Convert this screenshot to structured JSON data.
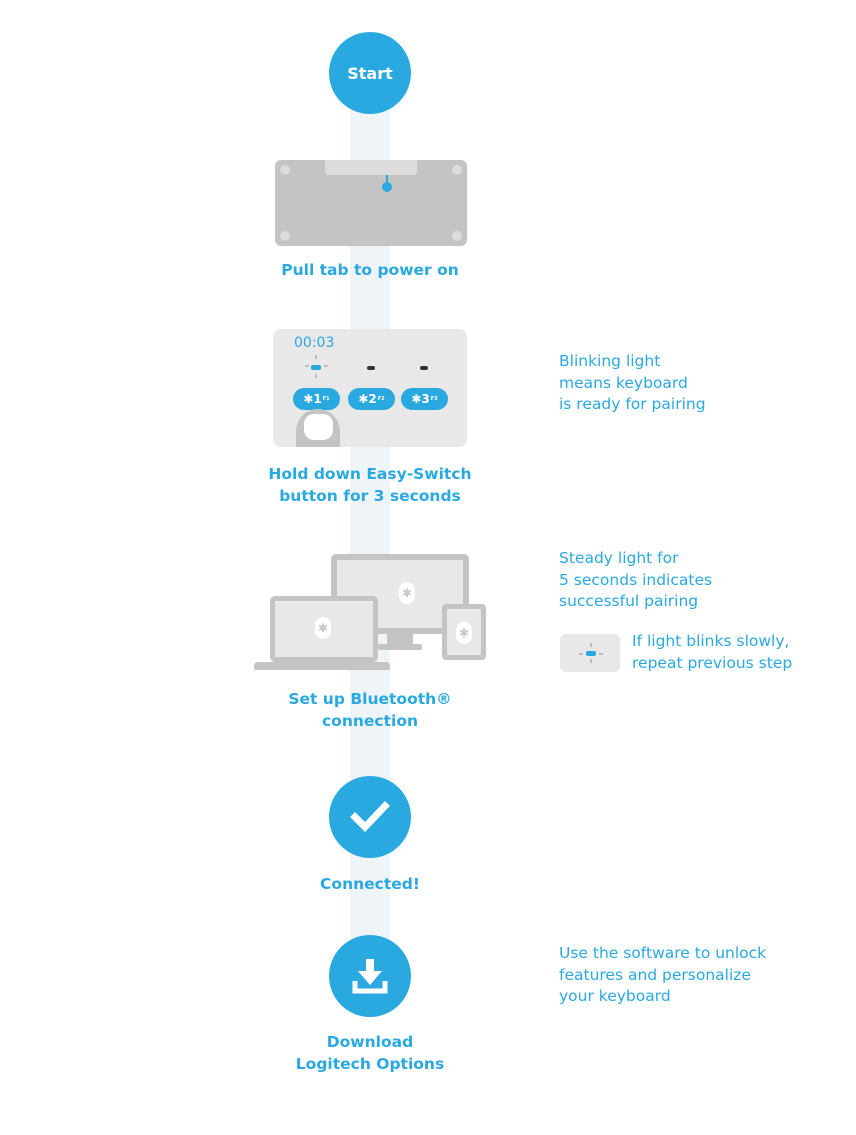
{
  "colors": {
    "accent": "#2aa8e0",
    "track": "#eef4f8",
    "device_gray": "#c4c4c4",
    "card_bg": "#e8e8e8"
  },
  "start": {
    "label": "Start"
  },
  "steps": [
    {
      "label": "Pull tab to power on"
    },
    {
      "label_line1": "Hold down Easy-Switch",
      "label_line2": "button for 3 seconds",
      "timer": "00:03",
      "keys": [
        {
          "num": "1",
          "fn": "F1"
        },
        {
          "num": "2",
          "fn": "F2"
        },
        {
          "num": "3",
          "fn": "F3"
        }
      ],
      "note": "Blinking light\nmeans keyboard\nis ready for pairing"
    },
    {
      "label_line1": "Set up Bluetooth®",
      "label_line2": "connection",
      "note": "Steady light for\n5 seconds indicates\nsuccessful pairing",
      "sub_note": "If light blinks slowly,\nrepeat previous step"
    },
    {
      "label": "Connected!",
      "icon": "checkmark-icon"
    },
    {
      "label_line1": "Download",
      "label_line2": "Logitech Options",
      "icon": "download-icon",
      "note": "Use the software to unlock\nfeatures and personalize\nyour keyboard"
    }
  ]
}
